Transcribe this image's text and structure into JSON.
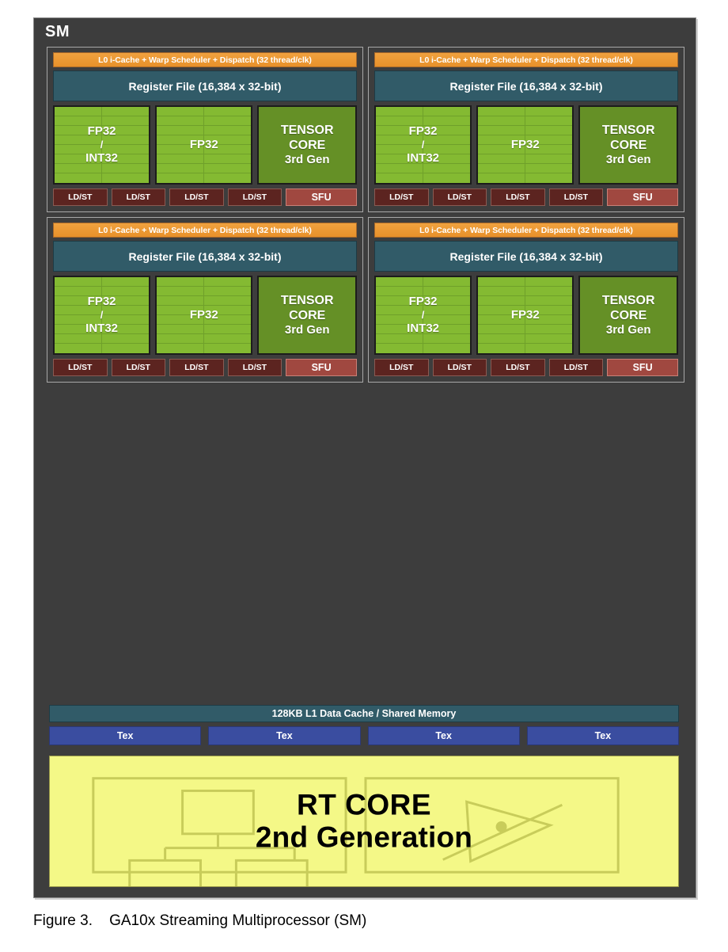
{
  "figure": {
    "label": "Figure 3.",
    "title": "GA10x Streaming Multiprocessor (SM)"
  },
  "sm": {
    "title": "SM",
    "partition_count": 4,
    "partition": {
      "dispatch": "L0 i-Cache + Warp Scheduler + Dispatch (32 thread/clk)",
      "register_file": "Register File (16,384 x 32-bit)",
      "fp32_int32": {
        "line1": "FP32",
        "line2": "/",
        "line3": "INT32"
      },
      "fp32": "FP32",
      "tensor_core": {
        "line1": "TENSOR",
        "line2": "CORE",
        "line3": "3rd Gen"
      },
      "ldst": "LD/ST",
      "ldst_count": 4,
      "sfu": "SFU",
      "fp32_grid": {
        "columns": 2,
        "rows": 8
      }
    },
    "l1_cache": "128KB L1 Data Cache / Shared Memory",
    "tex": "Tex",
    "tex_count": 4,
    "rt_core": {
      "line1": "RT CORE",
      "line2": "2nd Generation"
    }
  },
  "colors": {
    "sm_background": "#3d3d3d",
    "sm_border": "#8d8d8d",
    "dispatch_orange": "#e8912a",
    "register_file_teal": "#315b68",
    "fp32_green": "#84ba32",
    "tensor_core_green": "#659026",
    "ldst_maroon": "#5c2420",
    "sfu_red": "#a04840",
    "tex_blue": "#3a4da0",
    "rt_core_yellow": "#f4f887",
    "rt_core_line": "#c8cc5a",
    "text_white": "#ffffff",
    "text_black": "#000000"
  }
}
